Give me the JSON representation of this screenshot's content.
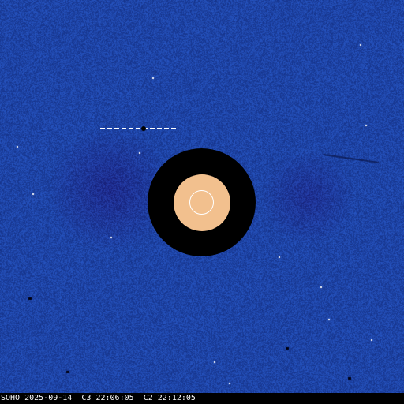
{
  "caption": {
    "observatory": "SOHO",
    "date": "2025-09-14",
    "c3_label": "C3",
    "c3_time": "22:06:05",
    "c2_label": "C2",
    "c2_time": "22:12:05"
  },
  "colors": {
    "background_blue": "#1f45a6",
    "occulter": "#000000",
    "inner_disk": "#f2c08e",
    "sun_outline": "#ffffff",
    "caption_text": "#ffffff"
  }
}
